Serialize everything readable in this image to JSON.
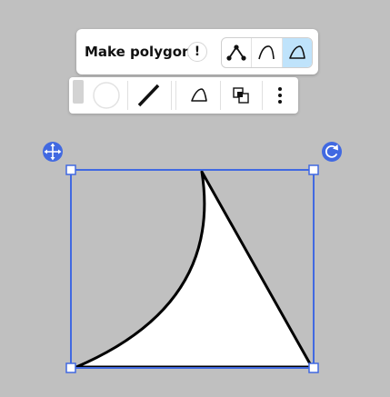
{
  "mode_bar": {
    "title": "Make polygon",
    "info_label": "!",
    "modes": [
      {
        "name": "polygon-points",
        "icon": "polygon-points-icon",
        "active": false
      },
      {
        "name": "curve",
        "icon": "curve-icon",
        "active": false
      },
      {
        "name": "closed-shape",
        "icon": "closed-shape-icon",
        "active": true
      }
    ]
  },
  "style_bar": {
    "tools": [
      {
        "icon": "fill-color-icon"
      },
      {
        "icon": "circle-stroke-icon"
      },
      {
        "icon": "line-thickness-icon"
      },
      {
        "icon": "shape-type-icon"
      },
      {
        "icon": "layer-order-icon"
      },
      {
        "icon": "more-vertical-icon"
      }
    ]
  },
  "selection": {
    "move_icon": "move-icon",
    "rotate_icon": "rotate-icon"
  },
  "colors": {
    "selection": "#4169e1",
    "background": "#c0c0c0",
    "active_mode": "#bfe3fb"
  }
}
